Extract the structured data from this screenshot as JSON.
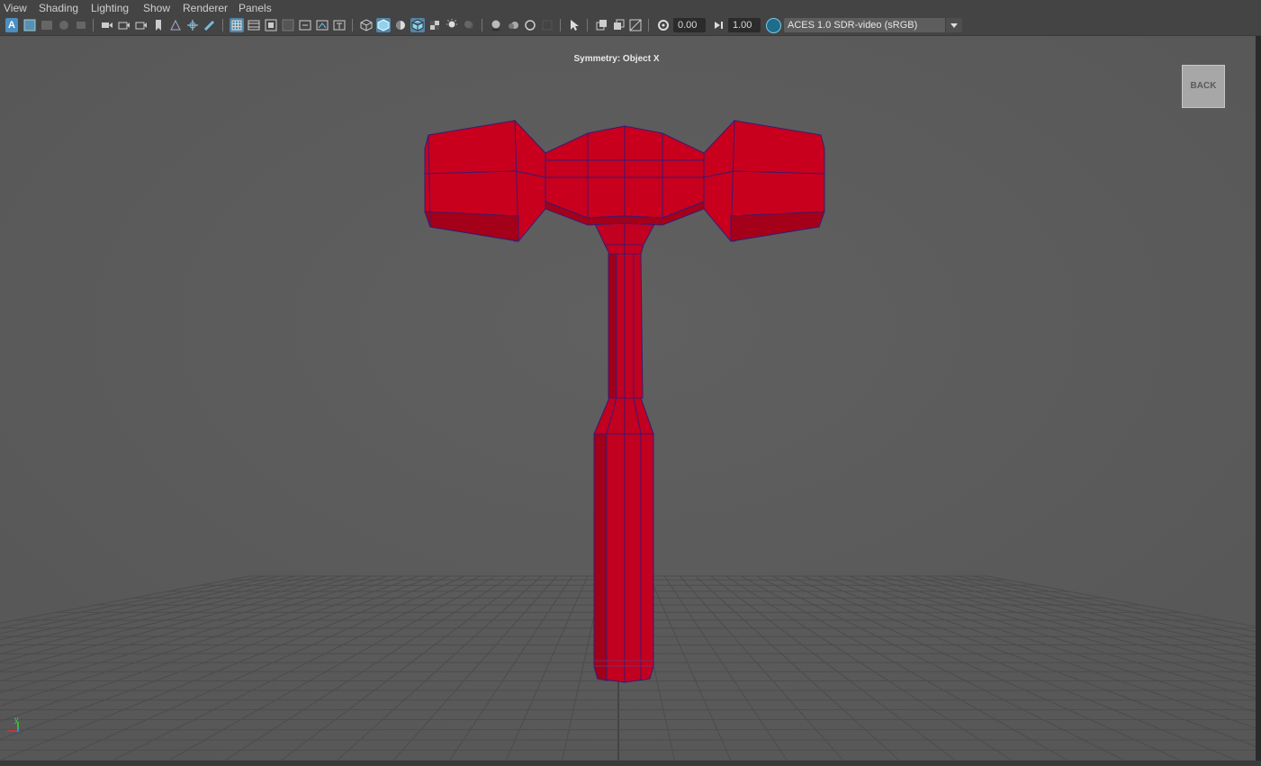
{
  "menu": [
    "View",
    "Shading",
    "Lighting",
    "Show",
    "Renderer",
    "Panels"
  ],
  "toolbar": {
    "exposure_value": "0.00",
    "gamma_value": "1.00",
    "color_space": "ACES 1.0 SDR-video (sRGB)"
  },
  "viewport": {
    "hud_text": "Symmetry: Object X",
    "back_label": "BACK",
    "axis_y_label": "y"
  },
  "colors": {
    "model": "#c8001e",
    "wire": "#3a1a72",
    "viewport_bg": "#5d5d5d",
    "grid": "#4a4a4a",
    "highlight": "#5285a6"
  },
  "icons": [
    "select-camera-icon",
    "camera-attributes-icon",
    "bookmark-icon",
    "image-plane-icon",
    "2d-pan-zoom-icon",
    "grease-pencil-icon",
    "grid-icon",
    "film-gate-icon",
    "resolution-gate-icon",
    "gate-mask-icon",
    "field-chart-icon",
    "safe-action-icon",
    "safe-title-icon",
    "wireframe-icon",
    "smooth-shade-icon",
    "default-material-icon",
    "wireframe-on-shaded-icon",
    "textured-icon",
    "use-all-lights-icon",
    "shadows-icon",
    "screen-space-ao-icon",
    "motion-blur-icon",
    "anti-aliasing-icon",
    "depth-of-field-icon",
    "isolate-select-icon",
    "xray-icon",
    "xray-joints-icon",
    "xray-components-icon",
    "exposure-icon",
    "gamma-icon",
    "color-management-icon"
  ]
}
